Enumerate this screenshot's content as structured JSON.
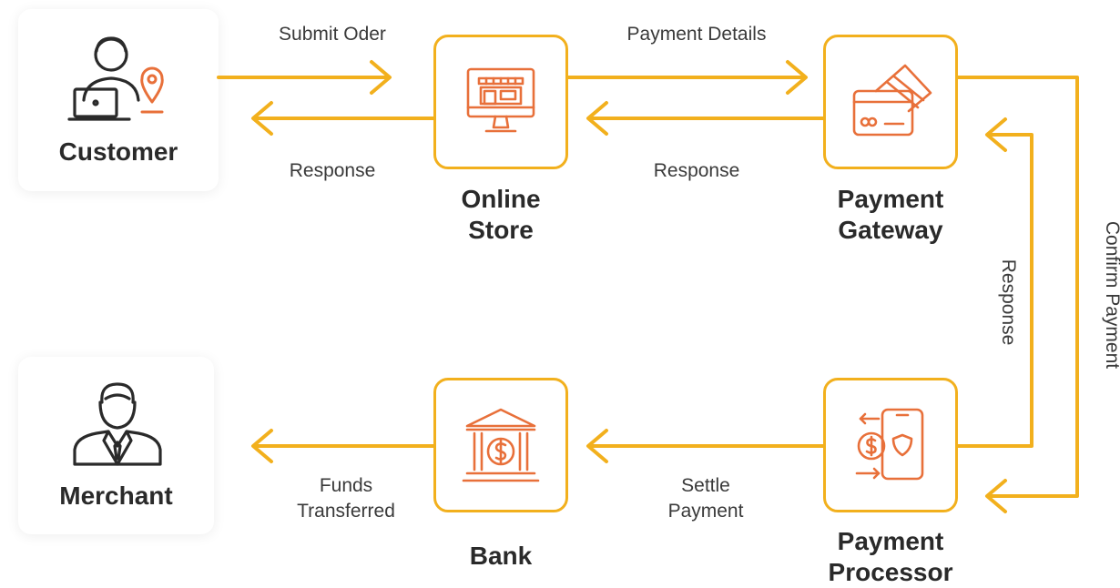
{
  "nodes": {
    "customer": {
      "label": "Customer",
      "icon": "customer-laptop-location-icon"
    },
    "online_store": {
      "line1": "Online",
      "line2": "Store",
      "icon": "storefront-monitor-icon"
    },
    "payment_gateway": {
      "line1": "Payment",
      "line2": "Gateway",
      "icon": "credit-card-icon"
    },
    "merchant": {
      "label": "Merchant",
      "icon": "businessman-icon"
    },
    "bank": {
      "label": "Bank",
      "icon": "bank-dollar-icon"
    },
    "payment_processor": {
      "line1": "Payment",
      "line2": "Processor",
      "icon": "mobile-payment-shield-icon"
    }
  },
  "flows": {
    "submit_order": "Submit Oder",
    "response_store_customer": "Response",
    "payment_details": "Payment Details",
    "response_gateway_store": "Response",
    "confirm_payment": "Confirm Payment",
    "response_processor_gateway": "Response",
    "settle_payment_1": "Settle",
    "settle_payment_2": "Payment",
    "funds_transferred_1": "Funds",
    "funds_transferred_2": "Transferred"
  },
  "colors": {
    "arrow": "#f2b01d",
    "box_border": "#f2b01d",
    "icon_orange": "#e8703a",
    "icon_dark": "#2a2a2a"
  }
}
